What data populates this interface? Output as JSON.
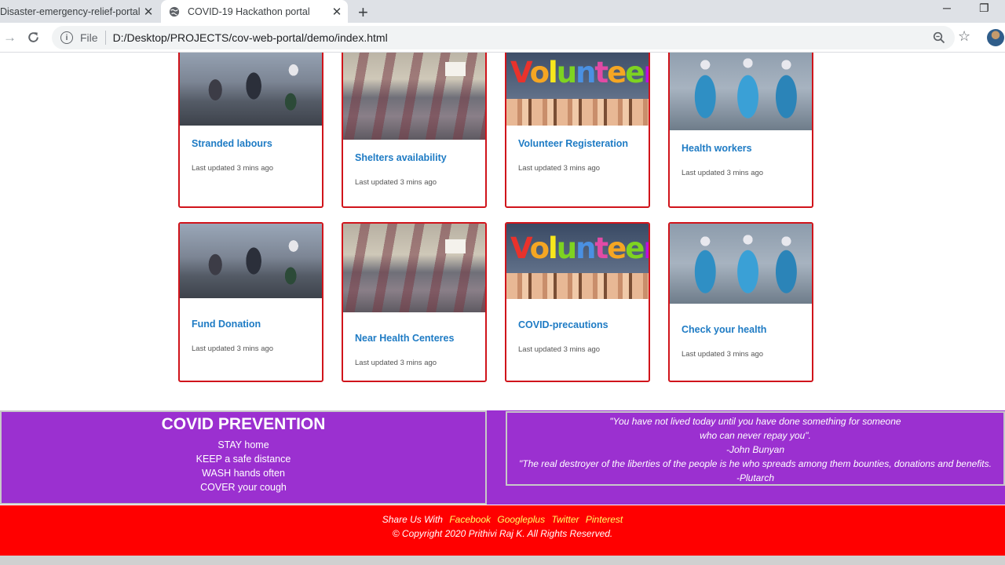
{
  "browser": {
    "tabs": [
      {
        "title": "Disaster-emergency-relief-portal",
        "active": false
      },
      {
        "title": "COVID-19 Hackathon portal",
        "active": true
      }
    ],
    "new_tab": "+",
    "close_glyph": "✕",
    "window_controls": {
      "minimize": "─",
      "restore": "❐"
    },
    "address": {
      "scheme_label": "File",
      "url": "D:/Desktop/PROJECTS/cov-web-portal/demo/index.html"
    },
    "icons": {
      "back": "back-arrow-icon",
      "reload": "reload-icon",
      "info": "info-icon",
      "zoom": "zoom-icon",
      "star": "bookmark-star-icon",
      "avatar": "profile-avatar-icon"
    }
  },
  "cards": [
    {
      "title": "Stranded labours",
      "updated": "Last updated 3 mins ago",
      "image": "labours"
    },
    {
      "title": "Shelters availability",
      "updated": "Last updated 3 mins ago",
      "image": "shelter"
    },
    {
      "title": "Volunteer Registeration",
      "updated": "Last updated 3 mins ago",
      "image": "volunteer"
    },
    {
      "title": "Health workers",
      "updated": "Last updated 3 mins ago",
      "image": "health"
    },
    {
      "title": "Fund Donation",
      "updated": "Last updated 3 mins ago",
      "image": "labours"
    },
    {
      "title": "Near Health Centeres",
      "updated": "Last updated 3 mins ago",
      "image": "shelter"
    },
    {
      "title": "COVID-precautions",
      "updated": "Last updated 3 mins ago",
      "image": "volunteer"
    },
    {
      "title": "Check your health",
      "updated": "Last updated 3 mins ago",
      "image": "health"
    }
  ],
  "volunteer_image_text": "Volunteer",
  "prevention": {
    "title": "COVID PREVENTION",
    "lines": [
      "STAY home",
      "KEEP a safe distance",
      "WASH hands often",
      "COVER your cough"
    ]
  },
  "quotes": [
    "\"You have not lived today until you have done something for someone",
    "who can never repay you\".",
    "-John Bunyan",
    "\"The real destroyer of the liberties of the people is he who spreads among them bounties, donations and benefits.",
    "-Plutarch"
  ],
  "footer": {
    "share_prefix": "Share Us With",
    "links": [
      "Facebook",
      "Googleplus",
      "Twitter",
      "Pinterest"
    ],
    "copyright": "© Copyright 2020 Prithivi Raj K. All Rights Reserved."
  },
  "colors": {
    "card_border": "#d0141b",
    "card_title": "#1e7bc4",
    "purple": "#9b30d0",
    "footer_red": "#ff0000",
    "link_yellow": "#ffff66"
  }
}
